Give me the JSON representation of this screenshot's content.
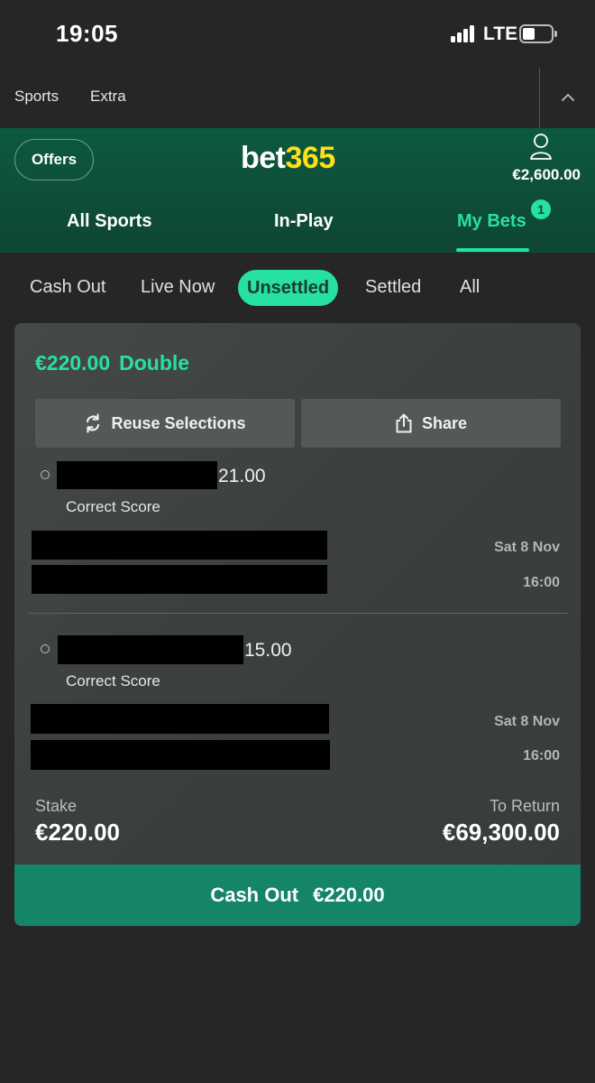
{
  "status_bar": {
    "time": "19:05",
    "network": "LTE"
  },
  "top_nav": {
    "items": [
      "Sports",
      "Extra"
    ]
  },
  "header": {
    "offers_label": "Offers",
    "logo_part1": "bet",
    "logo_part2": "365",
    "balance": "€2,600.00",
    "tabs": [
      {
        "label": "All Sports",
        "active": false
      },
      {
        "label": "In-Play",
        "active": false
      },
      {
        "label": "My Bets",
        "active": true,
        "badge": "1"
      }
    ]
  },
  "filters": [
    {
      "label": "Cash Out",
      "active": false
    },
    {
      "label": "Live Now",
      "active": false
    },
    {
      "label": "Unsettled",
      "active": true
    },
    {
      "label": "Settled",
      "active": false
    },
    {
      "label": "All",
      "active": false
    }
  ],
  "bet": {
    "amount": "€220.00",
    "type": "Double",
    "reuse_label": "Reuse Selections",
    "share_label": "Share",
    "selections": [
      {
        "odds": "21.00",
        "market": "Correct Score",
        "date": "Sat 8 Nov",
        "time": "16:00"
      },
      {
        "odds": "15.00",
        "market": "Correct Score",
        "date": "Sat 8 Nov",
        "time": "16:00"
      }
    ],
    "stake_label": "Stake",
    "stake": "€220.00",
    "return_label": "To Return",
    "return_value": "€69,300.00",
    "cashout_label": "Cash Out",
    "cashout_amount": "€220.00"
  },
  "colors": {
    "accent": "#27e0a4",
    "header_green": "#0b5a3e",
    "cashout_green": "#15856a",
    "logo_yellow": "#ffdf1b",
    "background": "#262626"
  },
  "icons": [
    "signal-icon",
    "battery-icon",
    "chevron-up-icon",
    "user-icon",
    "refresh-icon",
    "share-icon"
  ]
}
